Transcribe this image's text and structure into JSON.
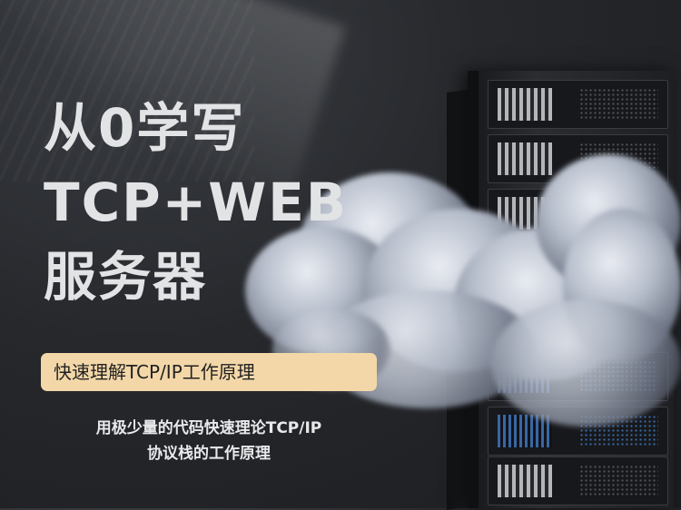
{
  "title": {
    "line1": "从0学写",
    "line2": "TCP+WEB",
    "line3": "服务器"
  },
  "badge": {
    "text": "快速理解TCP/IP工作原理"
  },
  "description": {
    "line1": "用极少量的代码快速理论TCP/IP",
    "line2": "协议栈的工作原理"
  },
  "colors": {
    "background": "#26282c",
    "title_text": "#e2e3e5",
    "badge_background": "#f3d7a8",
    "badge_text": "#222222"
  },
  "icons": {
    "illustration": "server-rack-with-clouds"
  }
}
